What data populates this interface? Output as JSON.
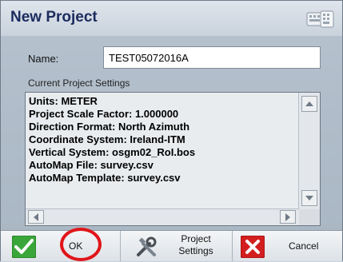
{
  "window": {
    "title": "New Project",
    "title_icon": "keyboard-icon"
  },
  "form": {
    "name_label": "Name:",
    "name_value": "TEST05072016A",
    "settings_caption": "Current Project Settings",
    "settings_lines": [
      "Units: METER",
      "Project Scale Factor: 1.000000",
      "Direction Format: North Azimuth",
      "Coordinate System: Ireland-ITM",
      "Vertical System: osgm02_RoI.bos",
      "AutoMap File: survey.csv",
      "AutoMap Template: survey.csv"
    ]
  },
  "toolbar": {
    "ok_label": "OK",
    "settings_label_line1": "Project",
    "settings_label_line2": "Settings",
    "cancel_label": "Cancel"
  },
  "colors": {
    "title_text": "#1c2b5e",
    "ok_check": "#2e9d2e",
    "cancel_red": "#d21e1e",
    "highlight_circle": "#e0161a"
  }
}
